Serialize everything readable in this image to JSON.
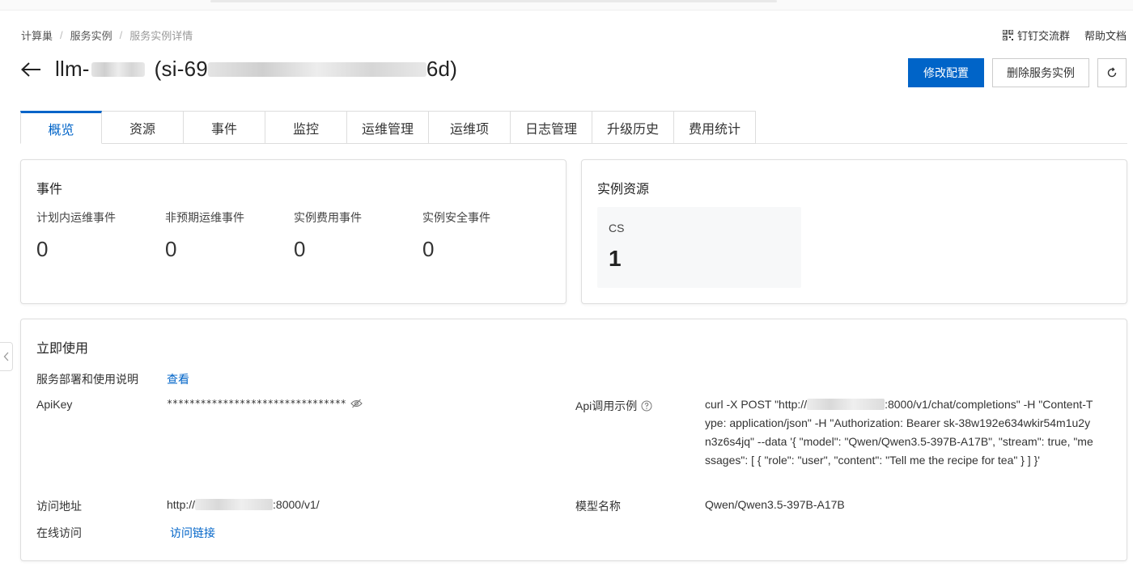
{
  "breadcrumb": [
    "计算巢",
    "服务实例",
    "服务实例详情"
  ],
  "help": {
    "dingtalk_label": "钉钉交流群",
    "docs_label": "帮助文档",
    "dingtalk_icon": "qrcode-icon"
  },
  "header": {
    "title_prefix": "llm-",
    "title_mid": "(si-69",
    "title_suffix": "6d)"
  },
  "actions": {
    "modify": "修改配置",
    "delete": "删除服务实例",
    "refresh_icon": "refresh-icon"
  },
  "tabs": [
    "概览",
    "资源",
    "事件",
    "监控",
    "运维管理",
    "运维项",
    "日志管理",
    "升级历史",
    "费用统计"
  ],
  "active_tab": "概览",
  "events": {
    "title": "事件",
    "items": [
      {
        "label": "计划内运维事件",
        "value": "0"
      },
      {
        "label": "非预期运维事件",
        "value": "0"
      },
      {
        "label": "实例费用事件",
        "value": "0"
      },
      {
        "label": "实例安全事件",
        "value": "0"
      }
    ]
  },
  "resources": {
    "title": "实例资源",
    "label": "CS",
    "value": "1"
  },
  "usage": {
    "title": "立即使用",
    "deploy_label": "服务部署和使用说明",
    "deploy_link": "查看",
    "apikey_label": "ApiKey",
    "apikey_value": "********************************",
    "api_example_label": "Api调用示例",
    "api_example_prefix": "curl -X POST \"http://",
    "api_example_rest": ":8000/v1/chat/completions\" -H \"Content-Type: application/json\" -H \"Authorization: Bearer sk-38w192e634wkir54m1u2yn3z6s4jq\" --data '{ \"model\": \"Qwen/Qwen3.5-397B-A17B\", \"stream\": true, \"messages\": [ { \"role\": \"user\", \"content\": \"Tell me the recipe for tea\" } ] }'",
    "address_label": "访问地址",
    "address_prefix": "http://",
    "address_suffix": ":8000/v1/",
    "model_label": "模型名称",
    "model_value": "Qwen/Qwen3.5-397B-A17B",
    "online_label": "在线访问",
    "online_link": "访问链接"
  },
  "colors": {
    "primary": "#0064c8",
    "border": "#dedede",
    "panel": "#f7f8f9"
  }
}
